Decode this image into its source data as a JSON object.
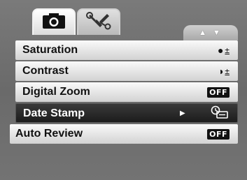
{
  "tabs": [
    {
      "icon": "camera-icon",
      "active": true
    },
    {
      "icon": "tools-icon",
      "active": false
    }
  ],
  "scroll": {
    "label": "▲ ▼"
  },
  "menu": {
    "items": [
      {
        "label": "Saturation",
        "value_icon": "saturation-icon",
        "symbol": "●",
        "adjust": "±"
      },
      {
        "label": "Contrast",
        "value_icon": "contrast-icon",
        "symbol": "◑",
        "adjust": "±"
      },
      {
        "label": "Digital Zoom",
        "value": "OFF"
      },
      {
        "label": "Date Stamp",
        "value_icon": "date-stamp-icon",
        "selected": true
      },
      {
        "label": "Auto Review",
        "value": "OFF"
      }
    ]
  }
}
